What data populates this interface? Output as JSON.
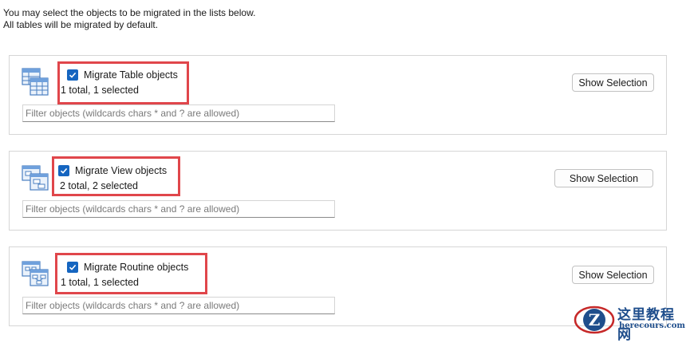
{
  "intro": {
    "line1": "You may select the objects to be migrated in the lists below.",
    "line2": "All tables will be migrated by default."
  },
  "panels": [
    {
      "icon": "table-objects-icon",
      "checkbox_label": "Migrate Table objects",
      "checked": true,
      "count_text": "1 total, 1 selected",
      "filter_placeholder": "Filter objects (wildcards chars * and ? are allowed)",
      "button_label": "Show Selection"
    },
    {
      "icon": "view-objects-icon",
      "checkbox_label": "Migrate View objects",
      "checked": true,
      "count_text": "2 total, 2 selected",
      "filter_placeholder": "Filter objects (wildcards chars * and ? are allowed)",
      "button_label": "Show Selection"
    },
    {
      "icon": "routine-objects-icon",
      "checkbox_label": "Migrate Routine objects",
      "checked": true,
      "count_text": "1 total, 1 selected",
      "filter_placeholder": "Filter objects (wildcards chars * and ? are allowed)",
      "button_label": "Show Selection"
    }
  ],
  "watermark": {
    "title": "这里教程网",
    "url": "herecours.com",
    "logo_letter": "Z"
  },
  "colors": {
    "checkbox": "#1565c0",
    "highlight": "#e0464b",
    "watermark": "#1f4e8c"
  }
}
